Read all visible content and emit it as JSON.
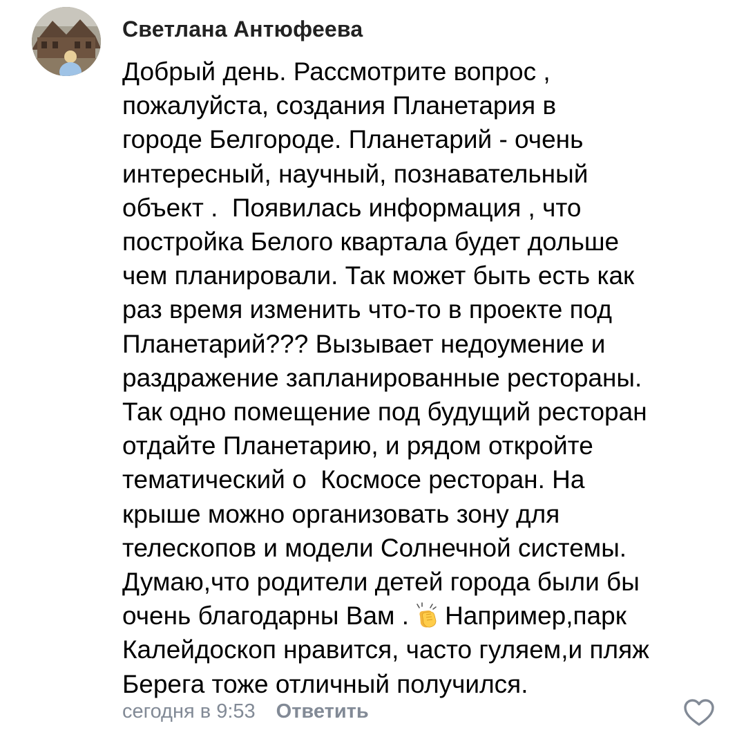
{
  "comment": {
    "author": "Светлана Антюфеева",
    "lines": [
      "Добрый день. Рассмотрите вопрос ,",
      "пожалуйста, создания Планетария в",
      "городе Белгороде. Планетарий - очень",
      "интересный, научный, познавательный",
      "объект .  Появилась информация , что",
      "постройка Белого квартала будет дольше",
      "чем планировали. Так может быть есть как",
      "раз время изменить что-то в проекте под",
      "Планетарий??? Вызывает недоумение и",
      "раздражение запланированные рестораны.",
      "Так одно помещение под будущий ресторан",
      "отдайте Планетарию, и рядом откройте",
      "тематический о  Космосе ресторан. На",
      "крыше можно организовать зону для",
      "телескопов и модели Солнечной системы.",
      "Думаю,что родители детей города были бы"
    ],
    "line_with_emoji": {
      "before": "очень благодарны Вам .",
      "emoji": "clapping-hands-icon",
      "after": "Например,парк"
    },
    "tail_lines": [
      "Калейдоскоп нравится, часто гуляем,и пляж",
      "Берега тоже отличный получился."
    ],
    "timestamp": "сегодня в 9:53",
    "reply_label": "Ответить",
    "like_icon": "heart-outline-icon",
    "avatar_icon": "user-avatar-photo"
  },
  "colors": {
    "text": "#000000",
    "author": "#222222",
    "meta": "#828a96",
    "background": "#ffffff"
  }
}
